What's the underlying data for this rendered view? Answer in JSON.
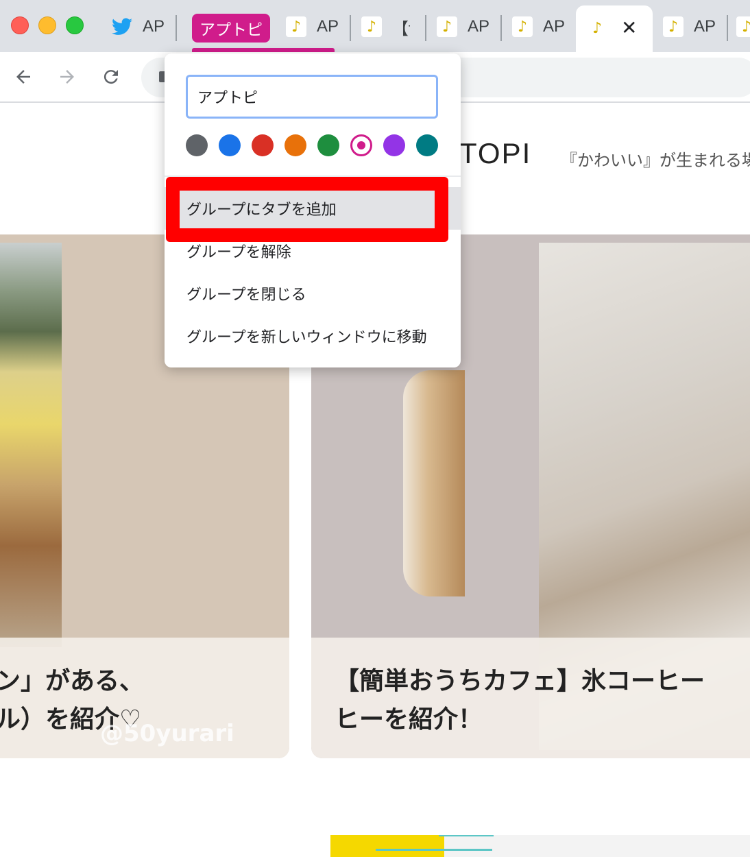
{
  "tabstrip": {
    "tabs": [
      {
        "label": "AP",
        "icon": "twitter-icon"
      },
      {
        "label": "AP",
        "icon": "apptopi-icon"
      },
      {
        "label": "【fi",
        "icon": "apptopi-icon"
      },
      {
        "label": "AP",
        "icon": "apptopi-icon"
      },
      {
        "label": "AP",
        "icon": "apptopi-icon"
      },
      {
        "label": "",
        "icon": "apptopi-icon"
      },
      {
        "label": "AP",
        "icon": "apptopi-icon"
      }
    ],
    "group_label": "アプトピ",
    "group_color": "#d01c8b",
    "close_glyph": "✕"
  },
  "group_menu": {
    "name_value": "アプトピ",
    "colors": [
      "#5f6368",
      "#1a73e8",
      "#d93025",
      "#e8710a",
      "#1e8e3e",
      "#d01c8b",
      "#9334e6",
      "#007b83"
    ],
    "selected_color": "#d01c8b",
    "items": [
      {
        "label": "グループにタブを追加"
      },
      {
        "label": "グループを解除"
      },
      {
        "label": "グループを閉じる"
      },
      {
        "label": "グループを新しいウィンドウに移動"
      }
    ],
    "highlight_color": "#ff0000"
  },
  "page": {
    "logo_text": "PTOPI",
    "tagline": "『かわいい』が生まれる場",
    "cards": [
      {
        "caption": "ン」がある、\nル）を紹介♡",
        "watermark": "@50yurari"
      },
      {
        "caption": "【簡単おうちカフェ】氷コーヒー\nヒーを紹介！"
      }
    ]
  }
}
